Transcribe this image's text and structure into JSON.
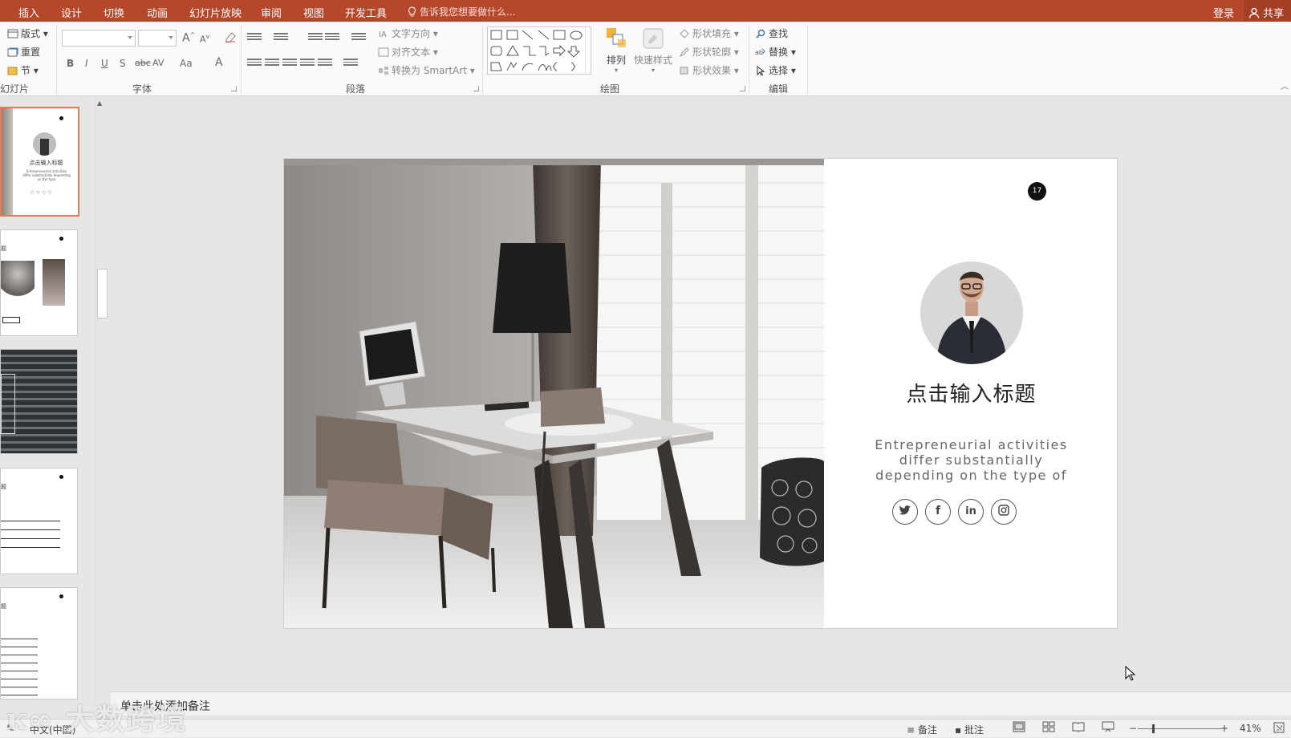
{
  "tabs": [
    "插入",
    "设计",
    "切换",
    "动画",
    "幻灯片放映",
    "审阅",
    "视图",
    "开发工具"
  ],
  "tell_me": "告诉我您想要做什么...",
  "account": {
    "login": "登录",
    "share": "共享"
  },
  "ribbon": {
    "slides": {
      "layout": "版式",
      "reset": "重置",
      "section": "节",
      "label": "幻灯片"
    },
    "font": {
      "label": "字体",
      "bold": "B",
      "italic": "I",
      "underline": "U",
      "shadow": "S",
      "strike": "abc",
      "spacing": "AV",
      "case": "Aa",
      "grow": "A",
      "shrink": "A",
      "color": "A"
    },
    "paragraph": {
      "label": "段落",
      "text_direction": "文字方向",
      "align_text": "对齐文本",
      "smartart": "转换为 SmartArt"
    },
    "drawing": {
      "label": "绘图",
      "arrange": "排列",
      "quick_styles": "快速样式",
      "shape_fill": "形状填充",
      "shape_outline": "形状轮廓",
      "shape_effects": "形状效果"
    },
    "editing": {
      "label": "编辑",
      "find": "查找",
      "replace": "替换",
      "select": "选择"
    }
  },
  "slide": {
    "number": "17",
    "title": "点击输入标题",
    "desc_lines": [
      "Entrepreneurial activities",
      "differ substantially",
      "depending on the type of"
    ],
    "social": [
      "twitter-icon",
      "facebook-icon",
      "linkedin-icon",
      "instagram-icon"
    ]
  },
  "thumb1": {
    "title": "点击输入标题",
    "desc": "Entrepreneurial activities differ substantially depending on the type"
  },
  "notes_placeholder": "单击此处添加备注",
  "status": {
    "language": "中文(中国)",
    "notes": "备注",
    "comments": "批注",
    "zoom": "41%"
  },
  "watermark": "大数跨境",
  "colors": {
    "accent": "#b7472a",
    "selected_thumb": "#e27a59"
  }
}
